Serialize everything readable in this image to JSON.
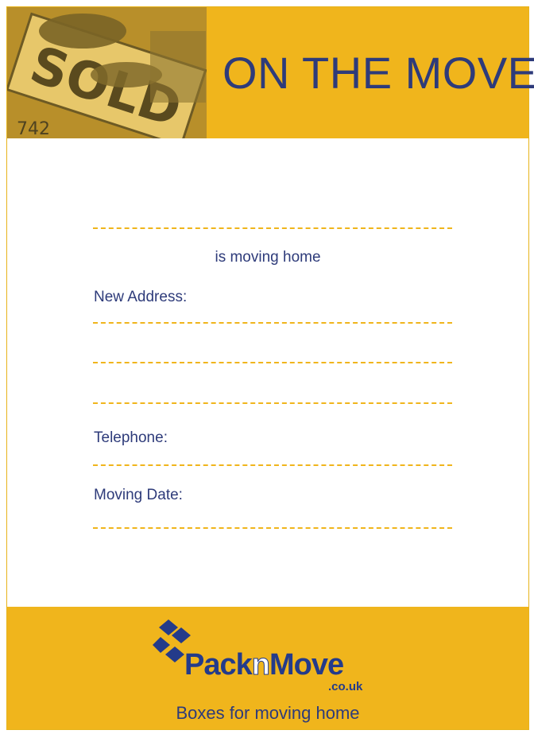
{
  "header": {
    "title": "ON THE MOVE",
    "photo_sign_text": "SOLD",
    "photo_sign_number": "742"
  },
  "form": {
    "moving_text": "is moving home",
    "new_address_label": "New Address:",
    "telephone_label": "Telephone:",
    "moving_date_label": "Moving Date:"
  },
  "footer": {
    "logo_pack": "Pack",
    "logo_n": "n",
    "logo_move": "Move",
    "logo_domain": ".co.uk",
    "tagline": "Boxes for moving home"
  },
  "colors": {
    "accent": "#f0b51c",
    "text": "#2e3b7a",
    "logo": "#243b8a"
  }
}
